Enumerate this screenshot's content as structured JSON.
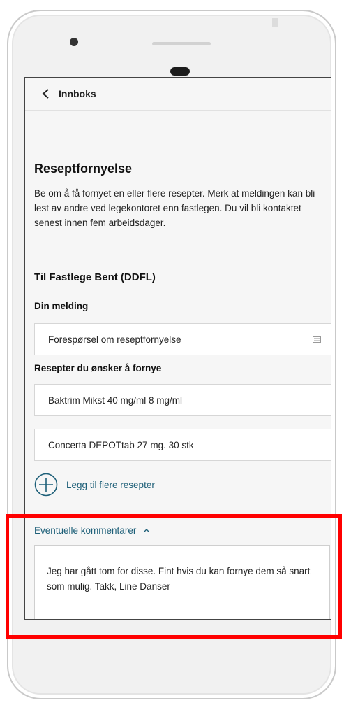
{
  "header": {
    "back_label": "Innboks"
  },
  "page": {
    "title": "Reseptfornyelse",
    "description": "Be om å få fornyet en eller flere resepter. Merk at meldingen kan bli lest av andre ved legekontoret enn fastlegen. Du vil bli kontaktet senest innen fem arbeidsdager.",
    "recipient": "Til Fastlege Bent (DDFL)"
  },
  "message": {
    "label": "Din melding",
    "value": "Forespørsel om reseptfornyelse"
  },
  "prescriptions": {
    "label": "Resepter du ønsker å fornye",
    "items": [
      "Baktrim Mikst 40 mg/ml 8 mg/ml",
      "Concerta DEPOTtab 27 mg. 30 stk"
    ],
    "add_label": "Legg til flere resepter"
  },
  "comments": {
    "toggle_label": "Eventuelle kommentarer",
    "value": "Jeg har gått tom for disse. Fint hvis du kan fornye dem så snart som mulig. Takk, Line Danser"
  },
  "colors": {
    "link": "#1d5f78",
    "highlight": "#ff0000",
    "screen_bg": "#f6f6f6"
  },
  "icons": [
    "chevron-left-icon",
    "keyboard-icon",
    "plus-circle-icon",
    "caret-up-icon"
  ]
}
